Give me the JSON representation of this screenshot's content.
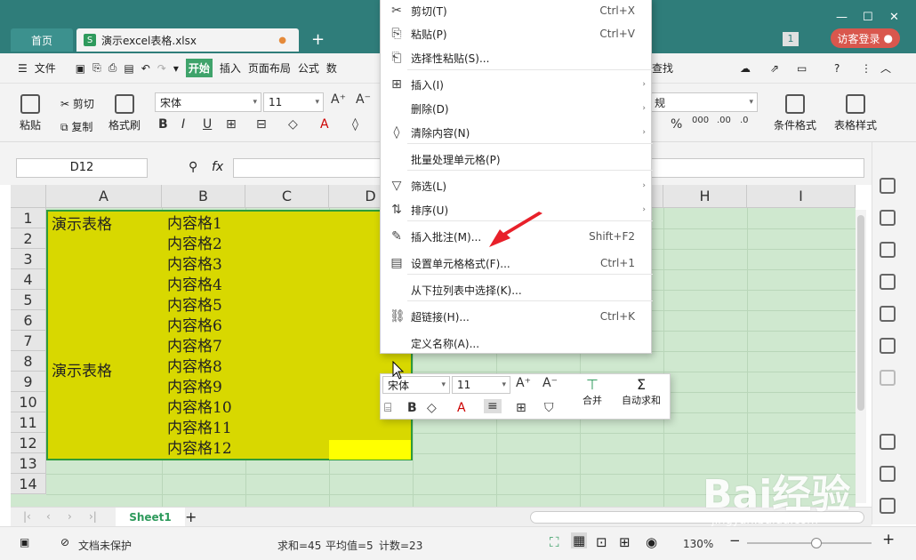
{
  "titlebar": {
    "home_tab": "首页",
    "doc_tab": "演示excel表格.xlsx",
    "doc_icon": "S",
    "login": "访客登录",
    "badge": "1"
  },
  "menu": {
    "file": "文件",
    "items": [
      "开始",
      "插入",
      "页面布局",
      "公式",
      "数"
    ],
    "find": "查找"
  },
  "ribbon": {
    "paste": "粘贴",
    "cut": "剪切",
    "copy": "复制",
    "format_painter": "格式刷",
    "font": "宋体",
    "size": "11",
    "number_format": "规",
    "cond_format": "条件格式",
    "table_style": "表格样式"
  },
  "formula": {
    "namebox": "D12",
    "fx": "fx"
  },
  "columns": [
    "A",
    "B",
    "C",
    "D",
    "",
    "",
    "H",
    "I"
  ],
  "rows": [
    "1",
    "2",
    "3",
    "4",
    "5",
    "6",
    "7",
    "8",
    "9",
    "10",
    "11",
    "12",
    "13",
    "14"
  ],
  "cells": {
    "a1": "演示表格",
    "a8": "演示表格",
    "b": [
      "内容格1",
      "内容格2",
      "内容格3",
      "内容格4",
      "内容格5",
      "内容格6",
      "内容格7",
      "内容格8",
      "内容格9",
      "内容格10",
      "内容格11",
      "内容格12"
    ]
  },
  "context_menu": [
    {
      "label": "剪切(T)",
      "shortcut": "Ctrl+X",
      "icon": "scissors-icon"
    },
    {
      "label": "粘贴(P)",
      "shortcut": "Ctrl+V",
      "icon": "paste-icon"
    },
    {
      "label": "选择性粘贴(S)...",
      "shortcut": "",
      "icon": "paste-special-icon"
    },
    {
      "label": "插入(I)",
      "shortcut": "",
      "icon": "insert-icon",
      "sub": true
    },
    {
      "label": "删除(D)",
      "shortcut": "",
      "icon": "",
      "sub": true
    },
    {
      "label": "清除内容(N)",
      "shortcut": "",
      "icon": "eraser-icon",
      "sub": true
    },
    {
      "label": "批量处理单元格(P)",
      "shortcut": "",
      "icon": ""
    },
    {
      "label": "筛选(L)",
      "shortcut": "",
      "icon": "filter-icon",
      "sub": true
    },
    {
      "label": "排序(U)",
      "shortcut": "",
      "icon": "sort-icon",
      "sub": true
    },
    {
      "label": "插入批注(M)...",
      "shortcut": "Shift+F2",
      "icon": "comment-icon"
    },
    {
      "label": "设置单元格格式(F)...",
      "shortcut": "Ctrl+1",
      "icon": "format-cells-icon"
    },
    {
      "label": "从下拉列表中选择(K)...",
      "shortcut": "",
      "icon": ""
    },
    {
      "label": "超链接(H)...",
      "shortcut": "Ctrl+K",
      "icon": "link-icon"
    },
    {
      "label": "定义名称(A)...",
      "shortcut": "",
      "icon": ""
    }
  ],
  "mini_toolbar": {
    "font": "宋体",
    "size": "11",
    "merge": "合并",
    "autosum": "自动求和"
  },
  "sheet_tab": "Sheet1",
  "status": {
    "protect": "文档未保护",
    "sum": "求和=45",
    "avg": "平均值=5",
    "count": "计数=23",
    "zoom": "130%"
  },
  "watermark": {
    "brand": "Bai经验",
    "sub": "jingyan.baidu.com"
  }
}
